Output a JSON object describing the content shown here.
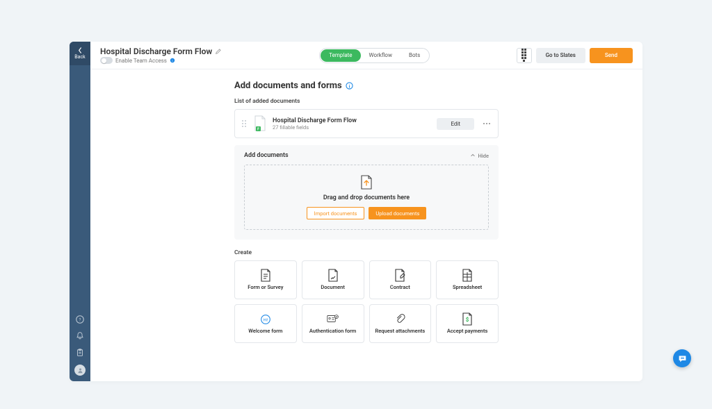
{
  "sidebar": {
    "back": "Back"
  },
  "header": {
    "title": "Hospital Discharge Form Flow",
    "team_access": "Enable Team Access",
    "tabs": {
      "template": "Template",
      "workflow": "Workflow",
      "bots": "Bots"
    },
    "go_to_slates": "Go to Slates",
    "send": "Send"
  },
  "section": {
    "heading": "Add documents and forms",
    "list_head": "List of added documents",
    "document": {
      "name": "Hospital Discharge Form Flow",
      "sub": "27 fillable fields",
      "edit": "Edit"
    },
    "add": {
      "title": "Add documents",
      "hide": "Hide",
      "dz_text": "Drag and drop documents here",
      "import": "Import documents",
      "upload": "Upload documents"
    },
    "create": {
      "title": "Create",
      "tiles": [
        "Form or Survey",
        "Document",
        "Contract",
        "Spreadsheet",
        "Welcome form",
        "Authentication form",
        "Request attachments",
        "Accept payments"
      ]
    }
  }
}
